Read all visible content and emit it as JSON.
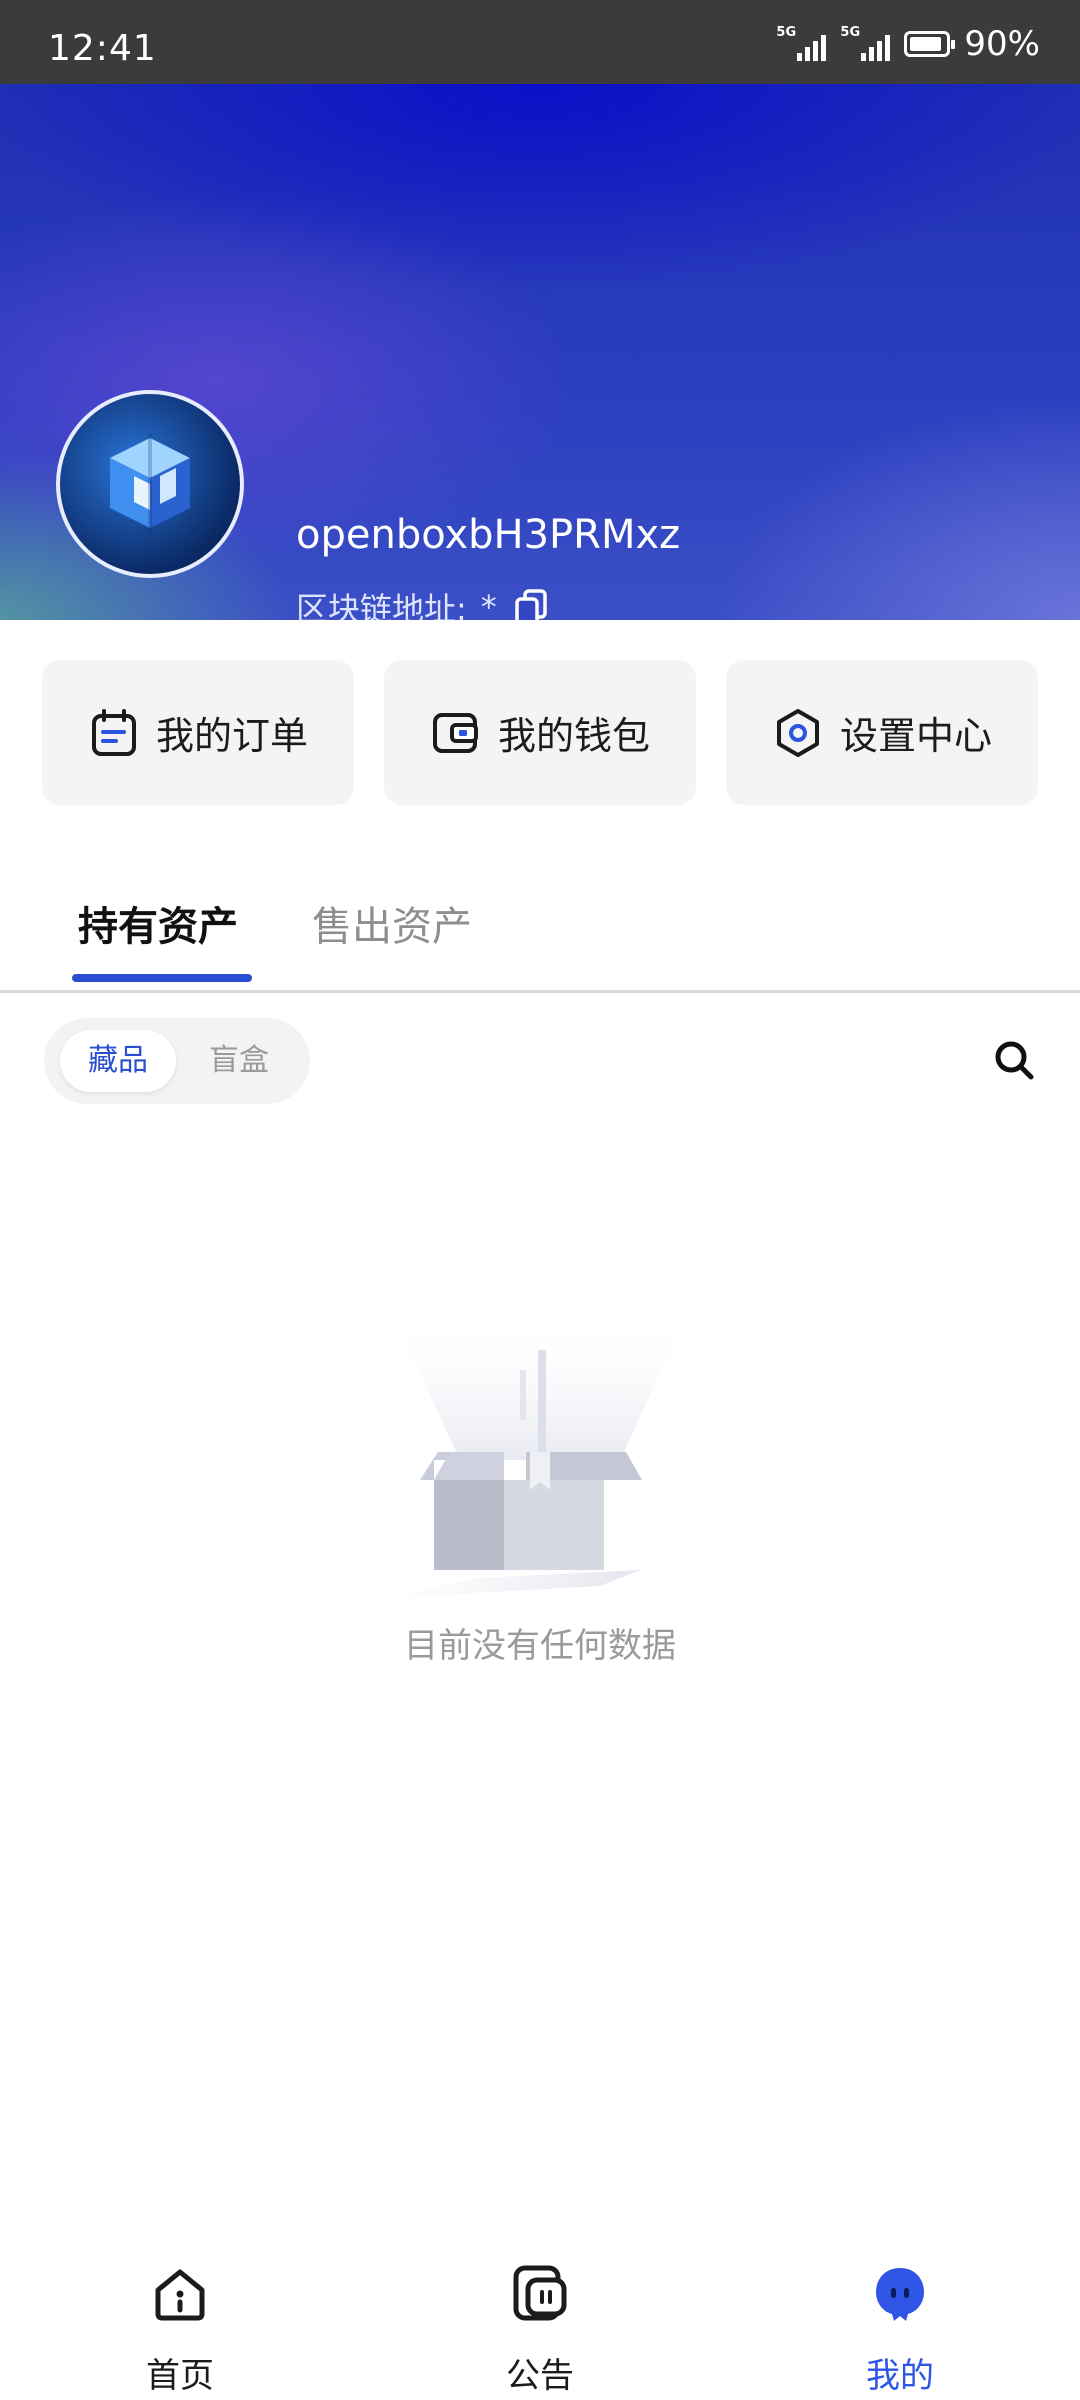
{
  "status_bar": {
    "time": "12:41",
    "signal_1": "5G",
    "signal_2": "5G",
    "battery_percent": "90%",
    "battery_level": 0.9
  },
  "profile": {
    "username": "openboxbH3PRMxz",
    "chain_address_label": "区块链地址:",
    "chain_address_value": "*"
  },
  "quick_actions": [
    {
      "label": "我的订单",
      "icon": "calendar-list-icon"
    },
    {
      "label": "我的钱包",
      "icon": "wallet-icon"
    },
    {
      "label": "设置中心",
      "icon": "hexagon-settings-icon"
    }
  ],
  "tabs": {
    "held_assets": "持有资产",
    "sold_assets": "售出资产",
    "active": "held_assets"
  },
  "filter": {
    "collectibles": "藏品",
    "blind_box": "盲盒",
    "active": "collectibles"
  },
  "empty_state": {
    "message": "目前没有任何数据"
  },
  "bottom_nav": {
    "home": "首页",
    "announcements": "公告",
    "me": "我的",
    "active": "me"
  },
  "colors": {
    "accent": "#2a4fd2",
    "status_bar_bg": "#3b3b3b"
  }
}
